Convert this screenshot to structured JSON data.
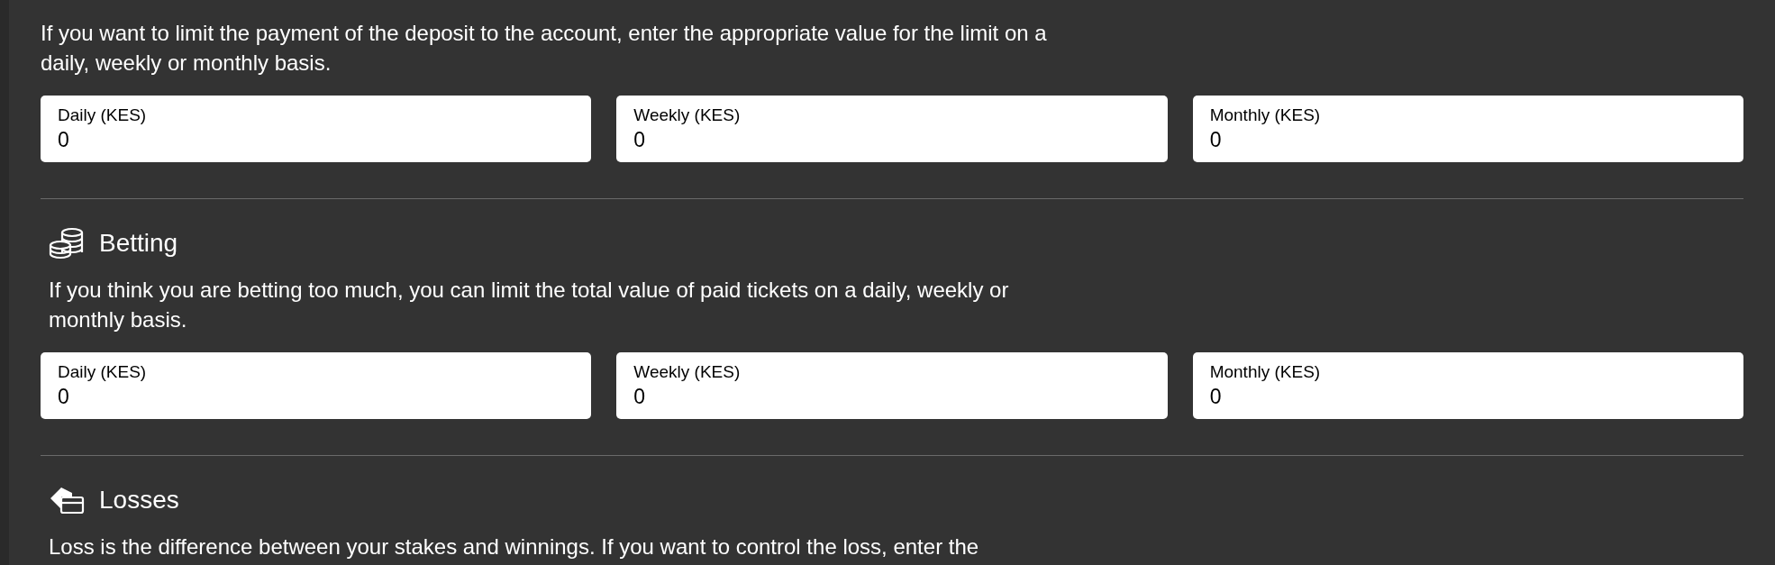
{
  "sections": [
    {
      "description": "If you want to limit the payment of the deposit to the account, enter the appropriate value for the limit on a daily, weekly or monthly basis.",
      "fields": [
        {
          "label": "Daily (KES)",
          "value": "0"
        },
        {
          "label": "Weekly (KES)",
          "value": "0"
        },
        {
          "label": "Monthly (KES)",
          "value": "0"
        }
      ]
    },
    {
      "kind": "coins",
      "title": "Betting",
      "description": "If you think you are betting too much, you can limit the total value of paid tickets on a daily, weekly or monthly basis.",
      "fields": [
        {
          "label": "Daily (KES)",
          "value": "0"
        },
        {
          "label": "Weekly (KES)",
          "value": "0"
        },
        {
          "label": "Monthly (KES)",
          "value": "0"
        }
      ]
    },
    {
      "kind": "card",
      "title": "Losses",
      "description": "Loss is the difference between your stakes and winnings. If you want to control the loss, enter the"
    }
  ]
}
